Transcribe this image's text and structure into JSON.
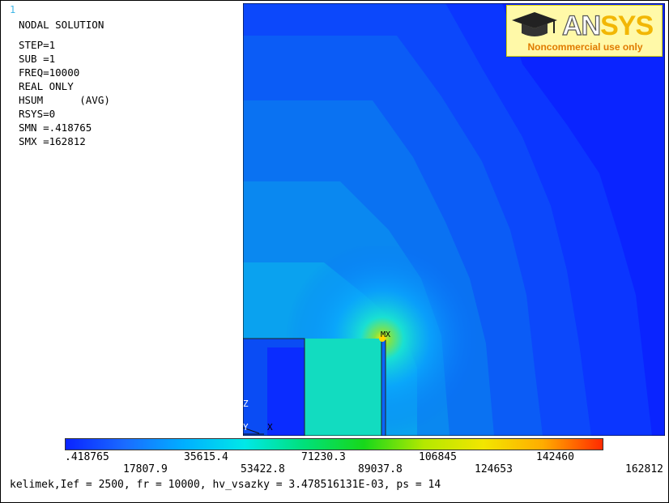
{
  "window_number": "1",
  "info": {
    "title": "NODAL SOLUTION",
    "step": "STEP=1",
    "sub": "SUB =1",
    "freq": "FREQ=10000",
    "real": "REAL ONLY",
    "hsum": "HSUM      (AVG)",
    "rsys": "RSYS=0",
    "smn": "SMN =.418765",
    "smx": "SMX =162812"
  },
  "logo": {
    "word_an": "AN",
    "word_sys": "SYS",
    "note": "Noncommercial use only"
  },
  "plot": {
    "mx_label": "MX",
    "axis_z": "Z",
    "axis_y": "Y",
    "axis_x": "X"
  },
  "legend": {
    "colors": [
      "#0a24ff",
      "#1a6cff",
      "#00b0ff",
      "#00e8e8",
      "#00e07a",
      "#17d81a",
      "#b4e800",
      "#f2e600",
      "#ffac00",
      "#ff2a00"
    ],
    "top_labels": [
      ".418765",
      "35615.4",
      "71230.3",
      "106845",
      "142460"
    ],
    "bottom_labels": [
      "17807.9",
      "53422.8",
      "89037.8",
      "124653",
      "162812"
    ]
  },
  "footer": "kelimek,Ief = 2500, fr = 10000, hv_vsazky = 3.478516131E-03, ps = 14"
}
